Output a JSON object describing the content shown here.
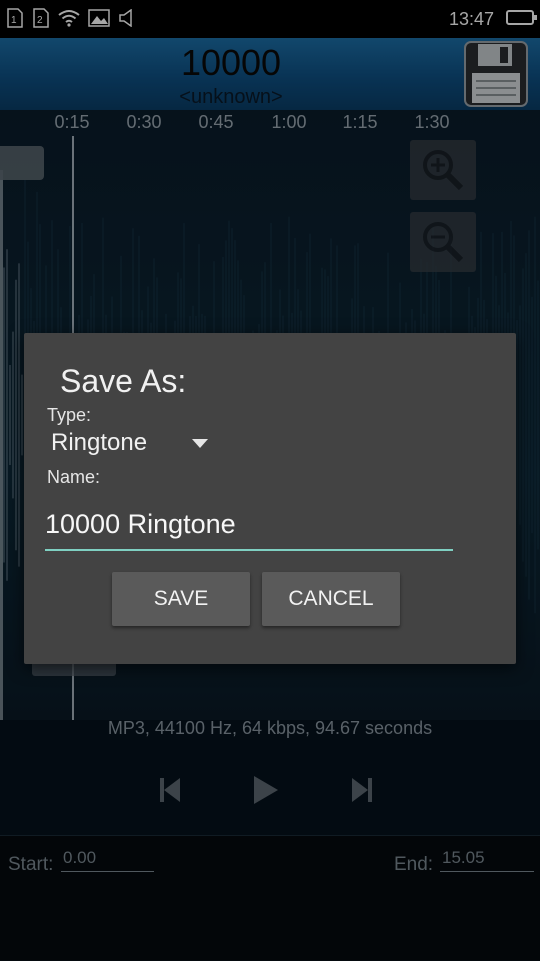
{
  "status_bar": {
    "sim1": "1",
    "sim2": "2",
    "time": "13:47",
    "icons": [
      "sim1-icon",
      "sim2-icon",
      "wifi-icon",
      "image-notification-icon",
      "volume-icon",
      "battery-icon"
    ]
  },
  "header": {
    "title": "10000",
    "subtitle": "<unknown>",
    "save_icon": "floppy-disk-icon"
  },
  "timeline": {
    "ticks": [
      "0:15",
      "0:30",
      "0:45",
      "1:00",
      "1:15",
      "1:30"
    ]
  },
  "zoom": {
    "zoom_in_icon": "zoom-in-icon",
    "zoom_out_icon": "zoom-out-icon"
  },
  "file_info": "MP3, 44100 Hz, 64 kbps, 94.67 seconds",
  "transport": {
    "icons": [
      "skip-previous-icon",
      "play-icon",
      "skip-next-icon"
    ]
  },
  "range": {
    "start_label": "Start:",
    "start_value": "0.00",
    "end_label": "End:",
    "end_value": "15.05"
  },
  "dialog": {
    "title": "Save As:",
    "type_label": "Type:",
    "type_value": "Ringtone",
    "name_label": "Name:",
    "name_value": "10000 Ringtone",
    "save_label": "SAVE",
    "cancel_label": "CANCEL"
  },
  "colors": {
    "accent_underline": "#7fd0c2",
    "dialog_bg": "#434343",
    "header_blue": "#1c6ea6"
  }
}
